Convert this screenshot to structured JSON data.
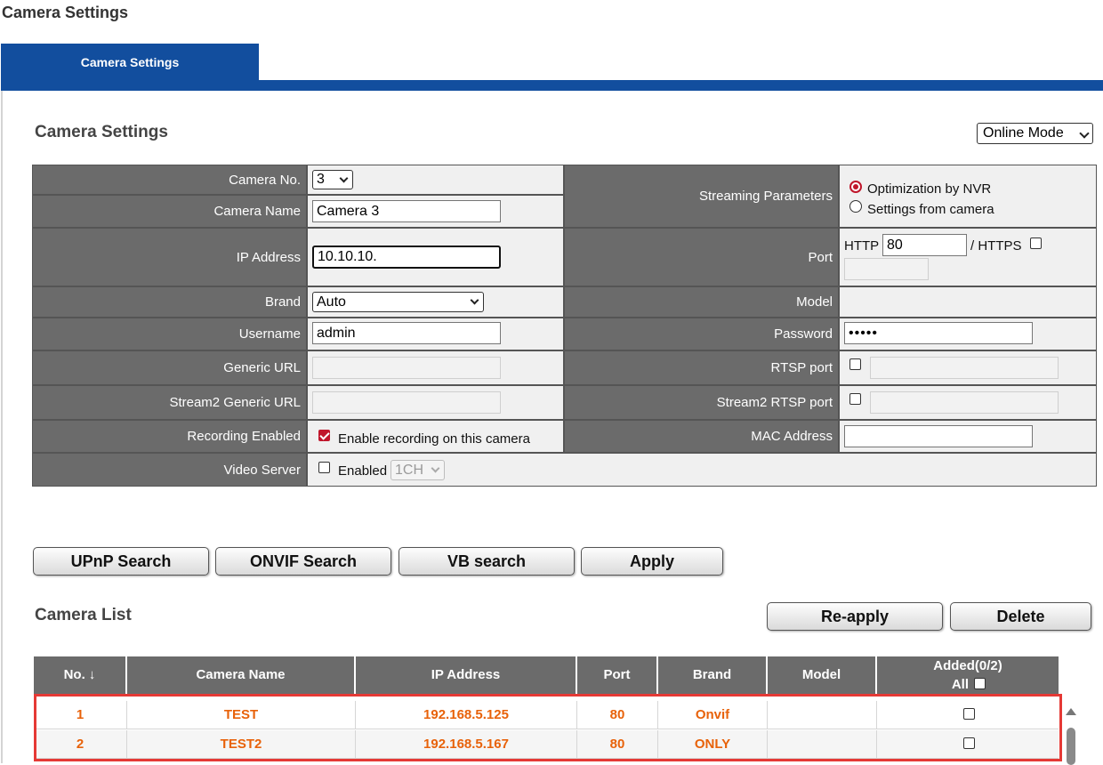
{
  "page_title": "Camera Settings",
  "tab_label": "Camera Settings",
  "settings_section_title": "Camera Settings",
  "mode_select_value": "Online Mode",
  "form": {
    "camera_no_label": "Camera No.",
    "camera_no_value": "3",
    "camera_name_label": "Camera Name",
    "camera_name_value": "Camera 3",
    "ip_label": "IP Address",
    "ip_value": "10.10.10.",
    "brand_label": "Brand",
    "brand_value": "Auto",
    "username_label": "Username",
    "username_value": "admin",
    "generic_url_label": "Generic URL",
    "stream2_generic_url_label": "Stream2 Generic URL",
    "recording_label": "Recording Enabled",
    "recording_text": "Enable recording on this camera",
    "video_server_label": "Video Server",
    "video_server_enabled_text": "Enabled",
    "video_server_channel": "1CH",
    "streaming_label": "Streaming Parameters",
    "streaming_option1": "Optimization by NVR",
    "streaming_option2": "Settings from camera",
    "port_label": "Port",
    "http_text": "HTTP",
    "http_value": "80",
    "https_text": "/ HTTPS",
    "model_label": "Model",
    "password_label": "Password",
    "password_value": "•••••",
    "rtsp_label": "RTSP port",
    "stream2_rtsp_label": "Stream2 RTSP port",
    "mac_label": "MAC Address"
  },
  "buttons": {
    "upnp": "UPnP Search",
    "onvif": "ONVIF Search",
    "vb": "VB search",
    "apply": "Apply",
    "reapply": "Re-apply",
    "delete": "Delete"
  },
  "camera_list_title": "Camera List",
  "table": {
    "headers": {
      "no": "No. ↓",
      "name": "Camera Name",
      "ip": "IP Address",
      "port": "Port",
      "brand": "Brand",
      "model": "Model",
      "added": "Added(0/2)",
      "all": "All"
    },
    "rows": [
      {
        "no": "1",
        "name": "TEST",
        "ip": "192.168.5.125",
        "port": "80",
        "brand": "Onvif",
        "model": ""
      },
      {
        "no": "2",
        "name": "TEST2",
        "ip": "192.168.5.167",
        "port": "80",
        "brand": "ONLY",
        "model": ""
      }
    ]
  },
  "colors": {
    "tab_blue": "#124e9e",
    "label_gray": "#6b6b6b",
    "row_text_orange": "#e8620a",
    "highlight_red": "#e53935",
    "check_red": "#c0162b"
  }
}
